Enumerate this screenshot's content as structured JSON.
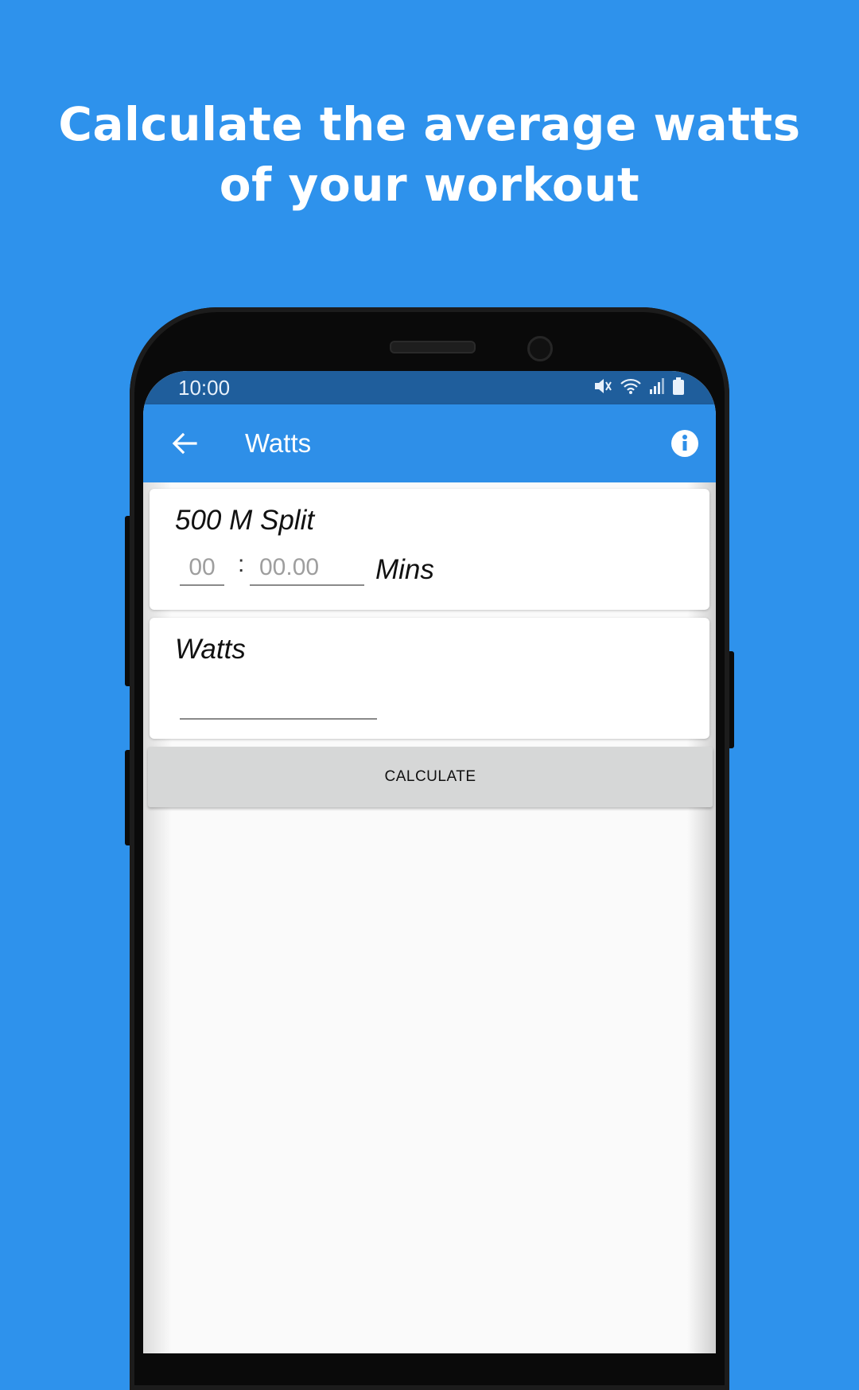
{
  "headline": {
    "line1": "Calculate the average watts",
    "line2": "of your workout"
  },
  "status_bar": {
    "time": "10:00",
    "icons": [
      "mute-icon",
      "wifi-icon",
      "signal-icon",
      "battery-icon"
    ]
  },
  "app_bar": {
    "back_icon": "arrow-left-icon",
    "title": "Watts",
    "info_icon": "info-icon"
  },
  "split_card": {
    "label": "500 M Split",
    "minutes_placeholder": "00",
    "separator": ":",
    "seconds_placeholder": "00.00",
    "unit": "Mins"
  },
  "watts_card": {
    "label": "Watts",
    "value": ""
  },
  "calculate_button": {
    "label": "CALCULATE"
  },
  "colors": {
    "background": "#2E92EC",
    "app_bar": "#2E8FE8",
    "status_bar": "#1F5E9C",
    "button": "#D6D7D7"
  }
}
